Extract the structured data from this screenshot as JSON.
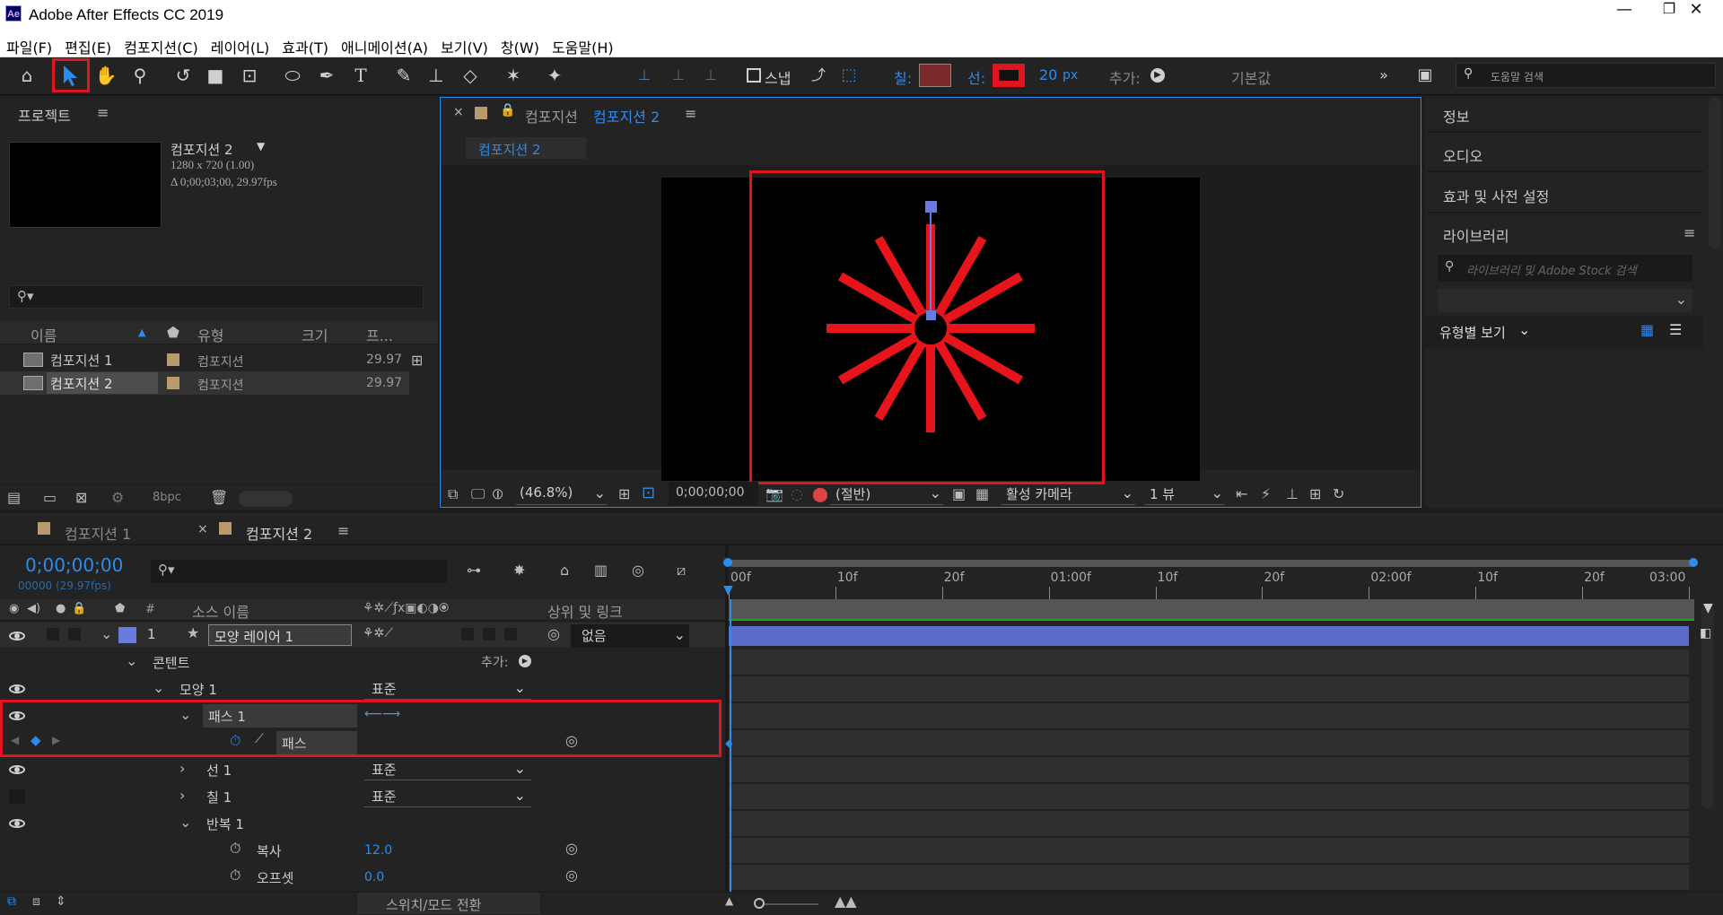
{
  "app": {
    "title": "Adobe After Effects CC 2019",
    "logo": "Ae"
  },
  "window_buttons": {
    "minimize": "—",
    "maximize": "❐",
    "close": "✕"
  },
  "menu": [
    "파일(F)",
    "편집(E)",
    "컴포지션(C)",
    "레이어(L)",
    "효과(T)",
    "애니메이션(A)",
    "보기(V)",
    "창(W)",
    "도움말(H)"
  ],
  "toolbar": {
    "snap_label": "스냅",
    "fill_label": "칠:",
    "stroke_label": "선:",
    "stroke_width": "20",
    "stroke_unit": "px",
    "add_label": "추가:",
    "workspace": "기본값",
    "help_search_placeholder": "도움말 검색",
    "fill_color": "#7a2a2a",
    "stroke_color": "#e0141e"
  },
  "project": {
    "title": "프로젝트",
    "selected_name": "컴포지션 2",
    "selected_info1": "1280 x 720 (1.00)",
    "selected_info2": "Δ 0;00;03;00, 29.97fps",
    "columns": {
      "name": "이름",
      "type": "유형",
      "size": "크기",
      "fps": "프..."
    },
    "items": [
      {
        "name": "컴포지션 1",
        "type": "컴포지션",
        "fps": "29.97"
      },
      {
        "name": "컴포지션 2",
        "type": "컴포지션",
        "fps": "29.97"
      }
    ],
    "bpc": "8bpc"
  },
  "composition": {
    "panel_prefix": "컴포지션",
    "panel_name": "컴포지션 2",
    "tab": "컴포지션 2",
    "zoom": "(46.8%)",
    "timecode": "0;00;00;00",
    "resolution": "(절반)",
    "camera": "활성 카메라",
    "views": "1 뷰",
    "spokes": 12,
    "spoke_color": "#e8141c"
  },
  "right_panels": {
    "info": "정보",
    "audio": "오디오",
    "effects": "효과 및 사전 설정",
    "library": "라이브러리",
    "library_search": "라이브러리 및 Adobe Stock 검색",
    "view_by_type": "유형별 보기"
  },
  "timeline": {
    "tabs": [
      "컴포지션 1",
      "컴포지션 2"
    ],
    "timecode": "0;00;00;00",
    "timecode_sub": "00000 (29.97fps)",
    "col_source": "소스 이름",
    "col_parent": "상위 및 링크",
    "col_num": "#",
    "ruler": [
      "00f",
      "10f",
      "20f",
      "01:00f",
      "10f",
      "20f",
      "02:00f",
      "10f",
      "20f",
      "03:00"
    ],
    "layer": {
      "num": "1",
      "name": "모양 레이어 1",
      "parent": "없음"
    },
    "rows": [
      {
        "label": "콘텐트",
        "add": "추가:"
      },
      {
        "label": "모양 1",
        "value": "표준"
      },
      {
        "label": "패스 1"
      },
      {
        "label": "패스"
      },
      {
        "label": "선 1",
        "value": "표준"
      },
      {
        "label": "칠 1",
        "value": "표준"
      },
      {
        "label": "반복 1"
      },
      {
        "label": "복사",
        "value": "12.0"
      },
      {
        "label": "오프셋",
        "value": "0.0"
      }
    ],
    "toggle_label": "스위치/모드 전환"
  }
}
